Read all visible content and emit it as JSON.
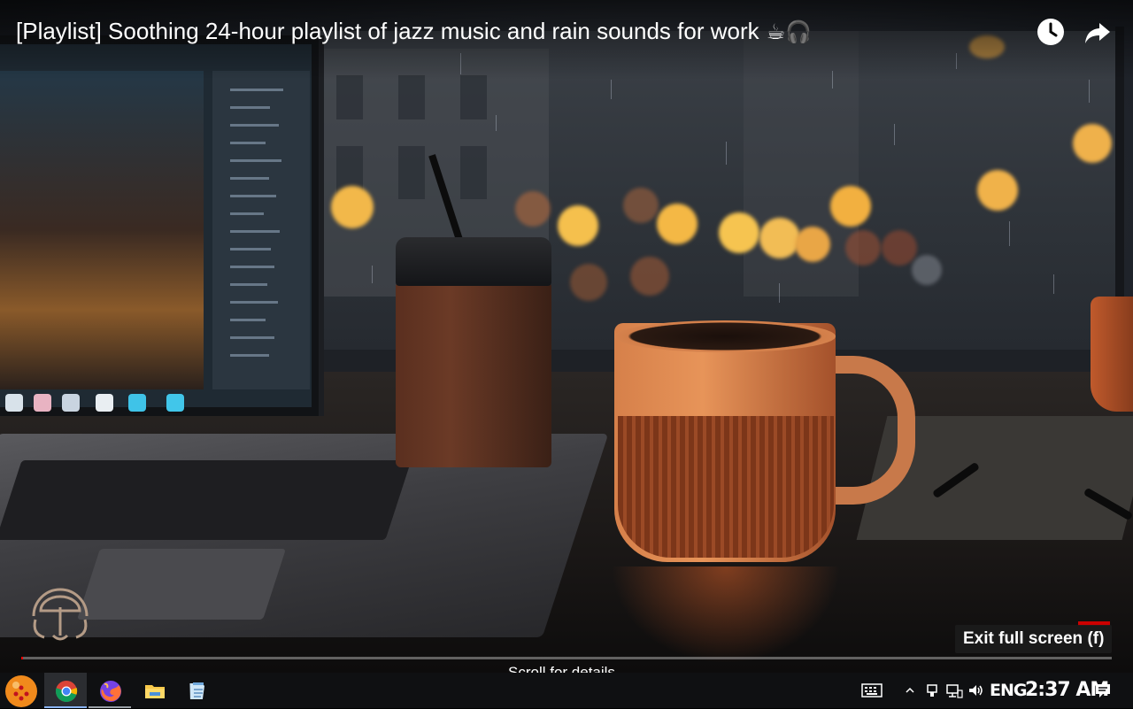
{
  "video": {
    "title": "[Playlist] Soothing 24-hour playlist of jazz music and rain sounds for work",
    "title_emojis": "☕🎧",
    "exit_fullscreen_tooltip": "Exit full screen (f)",
    "scroll_hint": "Scroll for details",
    "progress_fraction": 0.002,
    "icons": [
      "watch-later-icon",
      "share-icon"
    ]
  },
  "taskbar": {
    "apps": [
      {
        "name": "start-button",
        "icon": "dragon-ball-start-icon"
      },
      {
        "name": "chrome",
        "icon": "chrome-icon",
        "state": "active"
      },
      {
        "name": "firefox",
        "icon": "firefox-icon",
        "state": "running"
      },
      {
        "name": "file-explorer",
        "icon": "folder-icon"
      },
      {
        "name": "notepad",
        "icon": "notepad-icon"
      }
    ],
    "tray": {
      "language": "ENG",
      "time": "2:37 AM",
      "icons": [
        "keyboard-icon",
        "show-hidden-icons-chevron",
        "usb-icon",
        "network-icon",
        "volume-icon",
        "notification-icon"
      ]
    }
  },
  "colors": {
    "accent_progress": "#ff0000",
    "taskbar_bg": "#0f1012",
    "tooltip_bg": "#1c1c1c"
  }
}
